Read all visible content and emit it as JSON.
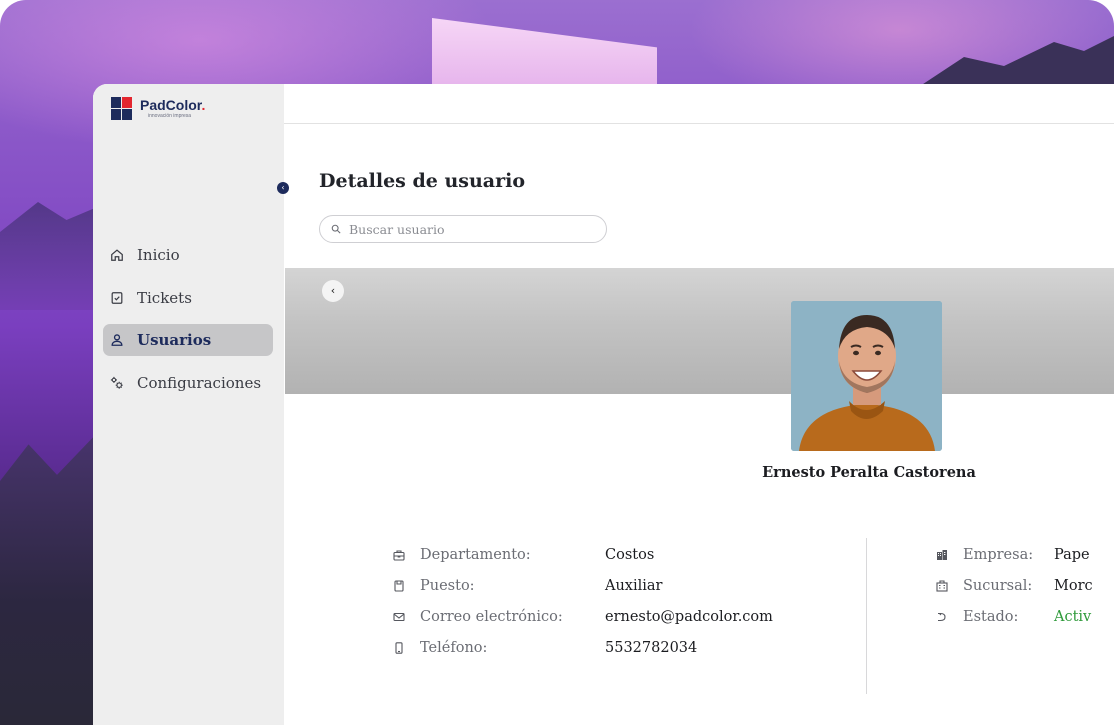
{
  "brand": {
    "name": "PadColor",
    "dot": ".",
    "tagline": "innovación impresa"
  },
  "sidebar": {
    "items": [
      {
        "label": "Inicio",
        "icon": "home-icon"
      },
      {
        "label": "Tickets",
        "icon": "ticket-check-icon"
      },
      {
        "label": "Usuarios",
        "icon": "user-icon"
      },
      {
        "label": "Configuraciones",
        "icon": "gears-icon"
      }
    ],
    "active_index": 2
  },
  "page": {
    "title": "Detalles de usuario",
    "search_placeholder": "Buscar usuario"
  },
  "user": {
    "name": "Ernesto Peralta Castorena",
    "avatar": "user-portrait"
  },
  "details_left": [
    {
      "label": "Departamento:",
      "value": "Costos",
      "icon": "briefcase-icon"
    },
    {
      "label": "Puesto:",
      "value": "Auxiliar",
      "icon": "id-card-icon"
    },
    {
      "label": "Correo electrónico:",
      "value": "ernesto@padcolor.com",
      "icon": "mail-icon"
    },
    {
      "label": "Teléfono:",
      "value": "5532782034",
      "icon": "phone-icon"
    }
  ],
  "details_right": [
    {
      "label": "Empresa:",
      "value": "Pape",
      "icon": "building-icon"
    },
    {
      "label": "Sucursal:",
      "value": "Morc",
      "icon": "branch-icon"
    },
    {
      "label": "Estado:",
      "value": "Activ",
      "icon": "status-icon"
    }
  ],
  "colors": {
    "brand_navy": "#1d2b5c",
    "brand_red": "#e3262f",
    "status_active": "#2e9a3a"
  }
}
